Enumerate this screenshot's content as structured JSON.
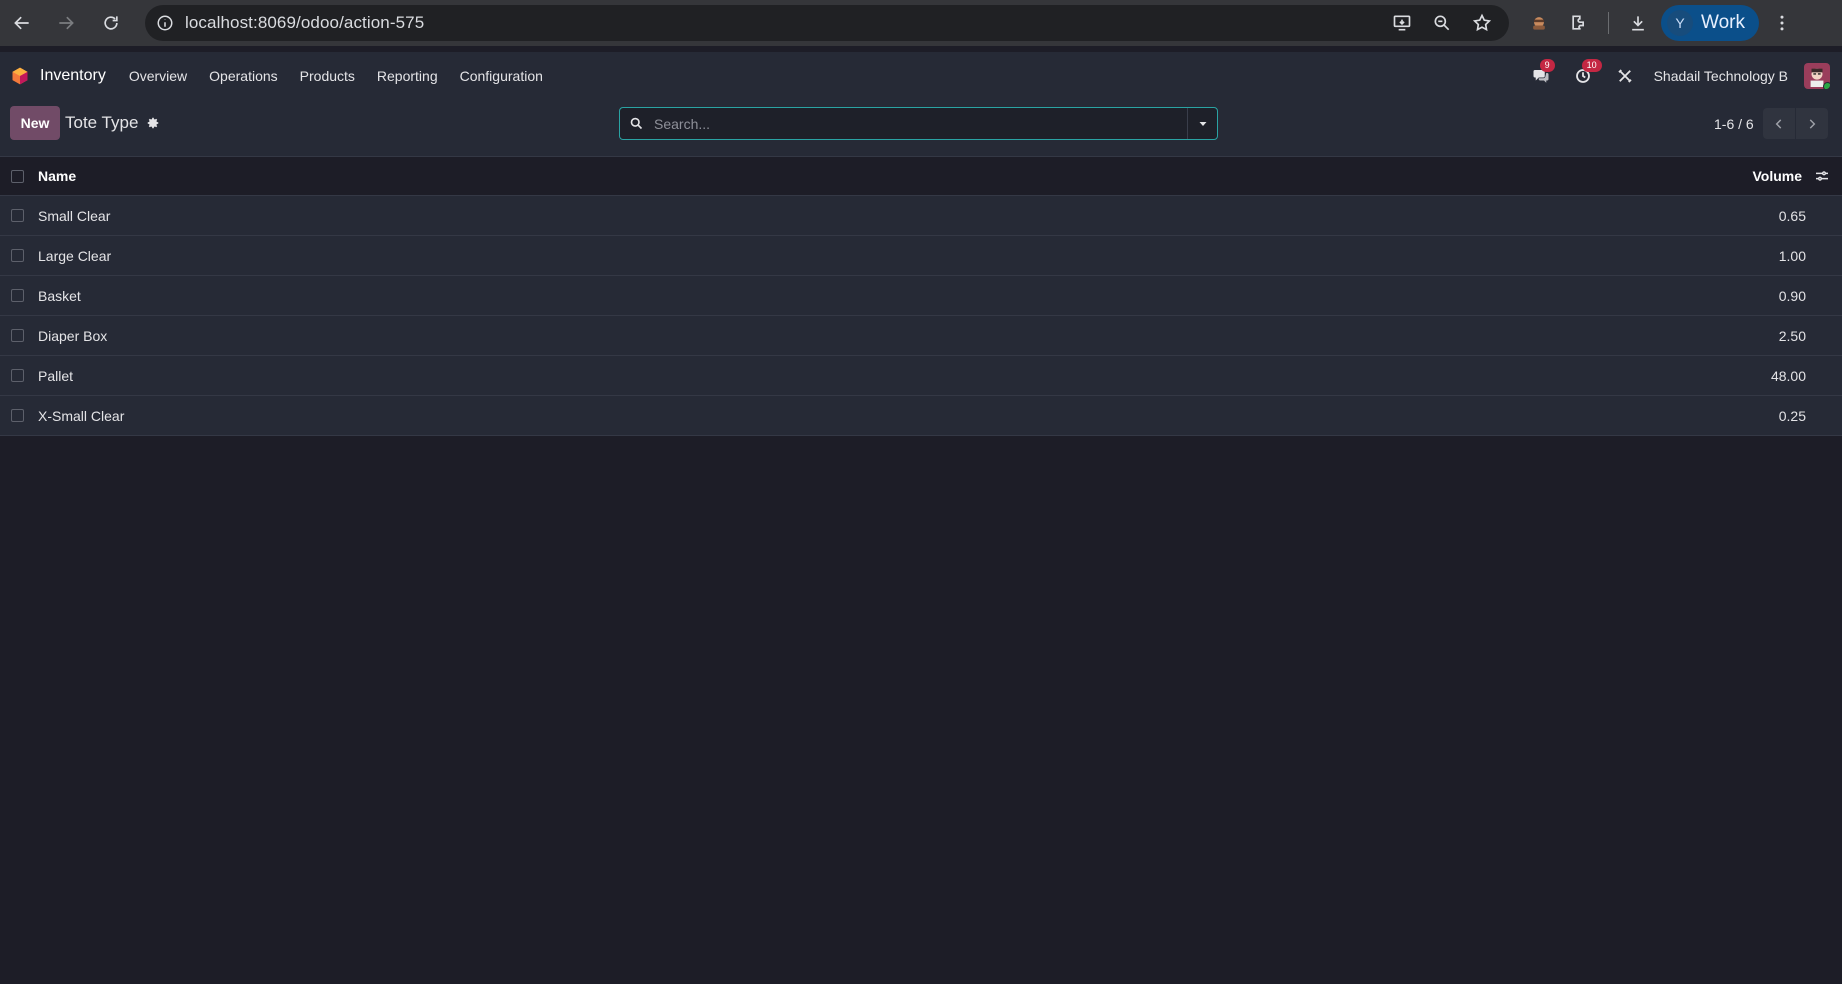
{
  "browser": {
    "url": "localhost:8069/odoo/action-575",
    "profile_initial": "Y",
    "profile_name": "Work"
  },
  "topnav": {
    "app_name": "Inventory",
    "menu": [
      "Overview",
      "Operations",
      "Products",
      "Reporting",
      "Configuration"
    ],
    "messages_count": "9",
    "activities_count": "10",
    "company": "Shadail Technology B"
  },
  "control": {
    "new_label": "New",
    "title": "Tote Type",
    "search_placeholder": "Search...",
    "pager": "1-6 / 6"
  },
  "list": {
    "columns": {
      "name": "Name",
      "volume": "Volume"
    },
    "rows": [
      {
        "name": "Small Clear",
        "volume": "0.65"
      },
      {
        "name": "Large Clear",
        "volume": "1.00"
      },
      {
        "name": "Basket",
        "volume": "0.90"
      },
      {
        "name": "Diaper Box",
        "volume": "2.50"
      },
      {
        "name": "Pallet",
        "volume": "48.00"
      },
      {
        "name": "X-Small Clear",
        "volume": "0.25"
      }
    ]
  },
  "colors": {
    "brand": "#714b67",
    "focus": "#2aa3a3",
    "badge": "#c42743"
  }
}
